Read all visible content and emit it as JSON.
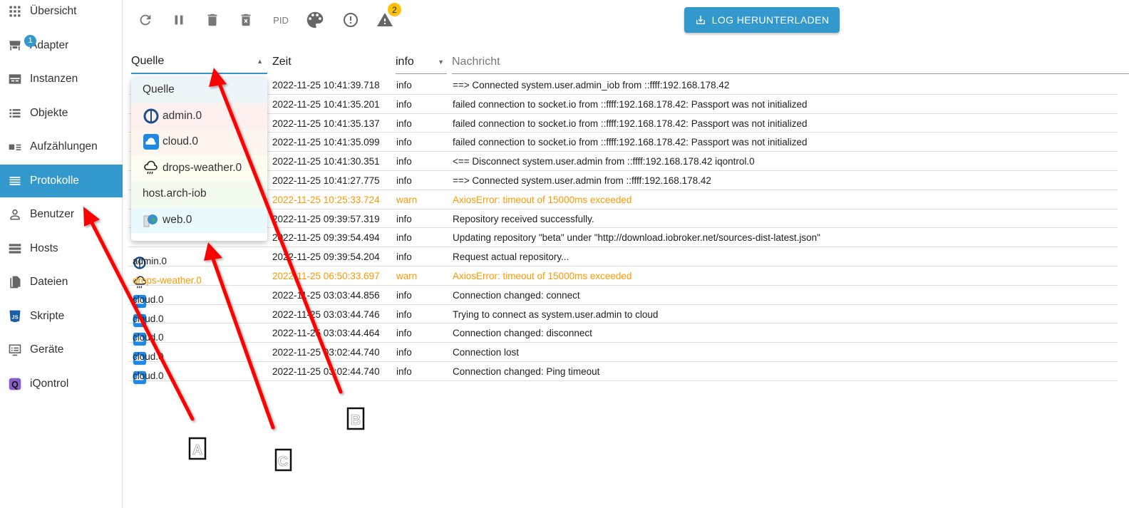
{
  "sidebar": {
    "items": [
      {
        "label": "Übersicht",
        "icon": "grid-icon"
      },
      {
        "label": "Adapter",
        "icon": "store-icon",
        "badge": "1"
      },
      {
        "label": "Instanzen",
        "icon": "instances-icon"
      },
      {
        "label": "Objekte",
        "icon": "list-icon"
      },
      {
        "label": "Aufzählungen",
        "icon": "enum-icon"
      },
      {
        "label": "Protokolle",
        "icon": "log-icon",
        "active": true
      },
      {
        "label": "Benutzer",
        "icon": "user-icon"
      },
      {
        "label": "Hosts",
        "icon": "hosts-icon"
      },
      {
        "label": "Dateien",
        "icon": "files-icon"
      },
      {
        "label": "Skripte",
        "icon": "javascript-icon"
      },
      {
        "label": "Geräte",
        "icon": "devices-icon"
      },
      {
        "label": "iQontrol",
        "icon": "iqontrol-icon"
      }
    ]
  },
  "toolbar": {
    "pid_label": "PID",
    "warn_badge": "2",
    "download_label": "LOG HERUNTERLADEN"
  },
  "table": {
    "headers": {
      "source": "Quelle",
      "time": "Zeit",
      "level": "info",
      "message": "Nachricht"
    },
    "rows": [
      {
        "source": "",
        "time": "2022-11-25 10:41:39.718",
        "level": "info",
        "message": "==> Connected system.user.admin_iob from ::ffff:192.168.178.42"
      },
      {
        "source": "",
        "time": "2022-11-25 10:41:35.201",
        "level": "info",
        "message": "failed connection to socket.io from ::ffff:192.168.178.42: Passport was not initialized"
      },
      {
        "source": "",
        "time": "2022-11-25 10:41:35.137",
        "level": "info",
        "message": "failed connection to socket.io from ::ffff:192.168.178.42: Passport was not initialized"
      },
      {
        "source": "",
        "time": "2022-11-25 10:41:35.099",
        "level": "info",
        "message": "failed connection to socket.io from ::ffff:192.168.178.42: Passport was not initialized"
      },
      {
        "source": "",
        "time": "2022-11-25 10:41:30.351",
        "level": "info",
        "message": "<== Disconnect system.user.admin from ::ffff:192.168.178.42 iqontrol.0"
      },
      {
        "source": "",
        "time": "2022-11-25 10:41:27.775",
        "level": "info",
        "message": "==> Connected system.user.admin from ::ffff:192.168.178.42"
      },
      {
        "source": "",
        "time": "2022-11-25 10:25:33.724",
        "level": "warn",
        "message": "AxiosError: timeout of 15000ms exceeded"
      },
      {
        "source": "",
        "time": "2022-11-25 09:39:57.319",
        "level": "info",
        "message": "Repository received successfully."
      },
      {
        "source": "",
        "time": "2022-11-25 09:39:54.494",
        "level": "info",
        "message": "Updating repository \"beta\" under \"http://download.iobroker.net/sources-dist-latest.json\""
      },
      {
        "source": "admin.0",
        "icon": "admin",
        "time": "2022-11-25 09:39:54.204",
        "level": "info",
        "message": "Request actual repository..."
      },
      {
        "source": "drops-weather.0",
        "icon": "weather",
        "time": "2022-11-25 06:50:33.697",
        "level": "warn",
        "message": "AxiosError: timeout of 15000ms exceeded"
      },
      {
        "source": "cloud.0",
        "icon": "cloud",
        "time": "2022-11-25 03:03:44.856",
        "level": "info",
        "message": "Connection changed: connect"
      },
      {
        "source": "cloud.0",
        "icon": "cloud",
        "time": "2022-11-25 03:03:44.746",
        "level": "info",
        "message": "Trying to connect as system.user.admin to cloud"
      },
      {
        "source": "cloud.0",
        "icon": "cloud",
        "time": "2022-11-25 03:03:44.464",
        "level": "info",
        "message": "Connection changed: disconnect"
      },
      {
        "source": "cloud.0",
        "icon": "cloud",
        "time": "2022-11-25 03:02:44.740",
        "level": "info",
        "message": "Connection lost"
      },
      {
        "source": "cloud.0",
        "icon": "cloud",
        "time": "2022-11-25 03:02:44.740",
        "level": "info",
        "message": "Connection changed: Ping timeout"
      }
    ]
  },
  "source_dropdown": {
    "items": [
      {
        "label": "Quelle",
        "icon": "",
        "bg": "#eef5f9"
      },
      {
        "label": "admin.0",
        "icon": "admin",
        "bg": "#fdf0ef"
      },
      {
        "label": "cloud.0",
        "icon": "cloud",
        "bg": "#fdf5ee"
      },
      {
        "label": "drops-weather.0",
        "icon": "weather",
        "bg": "#fdfdef"
      },
      {
        "label": "host.arch-iob",
        "icon": "",
        "bg": "#f3fbef"
      },
      {
        "label": "web.0",
        "icon": "web",
        "bg": "#eafafc"
      }
    ]
  },
  "annotations": [
    "A",
    "B",
    "C"
  ],
  "colors": {
    "accent": "#3399cc",
    "warn": "#ff9800",
    "annotation": "#ff0000"
  }
}
